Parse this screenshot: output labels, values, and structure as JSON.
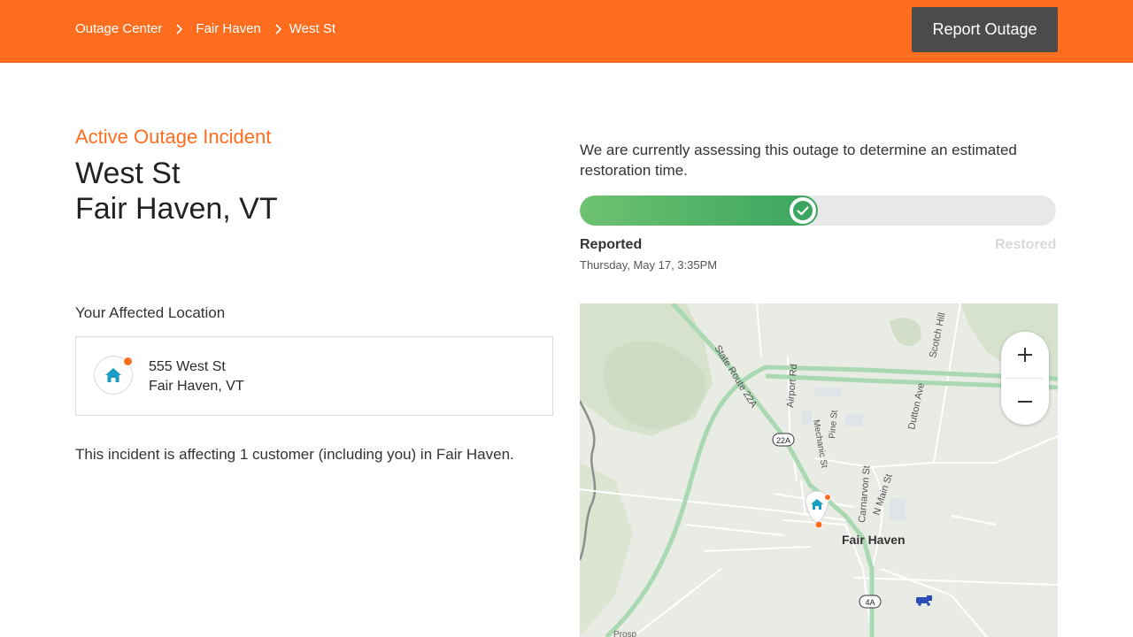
{
  "breadcrumbs": [
    "Outage Center",
    "Fair Haven",
    "West St"
  ],
  "header": {
    "report_button": "Report Outage"
  },
  "incident": {
    "eyebrow": "Active Outage Incident",
    "title_line1": "West St",
    "title_line2": "Fair Haven, VT"
  },
  "affected": {
    "label": "Your Affected Location",
    "address_line1": "555 West St",
    "address_line2": "Fair Haven, VT"
  },
  "impact_text": "This incident is affecting 1 customer (including you) in Fair Haven.",
  "status": {
    "message": "We are currently assessing this outage to determine an estimated restoration time.",
    "progress_percent": 50,
    "reported_label": "Reported",
    "reported_time": "Thursday, May 17, 3:35PM",
    "restored_label": "Restored"
  },
  "map": {
    "labels": {
      "state_route": "State Route 22A",
      "airport_rd": "Airport Rd",
      "scotch_hill": "Scotch Hill",
      "dutton_ave": "Dutton Ave",
      "mechanic_st": "Mechanic St",
      "pine_st": "Pine St",
      "carnarvon_st": "Carnarvon St",
      "n_main_st": "N Main St",
      "town": "Fair Haven",
      "shield_22a": "22A",
      "shield_4a": "4A",
      "prospect": "Prosp"
    }
  },
  "colors": {
    "brand": "#ff6d1f",
    "progress_start": "#6ec271",
    "progress_end": "#3aa55f",
    "header_btn": "#4b4b4b"
  }
}
